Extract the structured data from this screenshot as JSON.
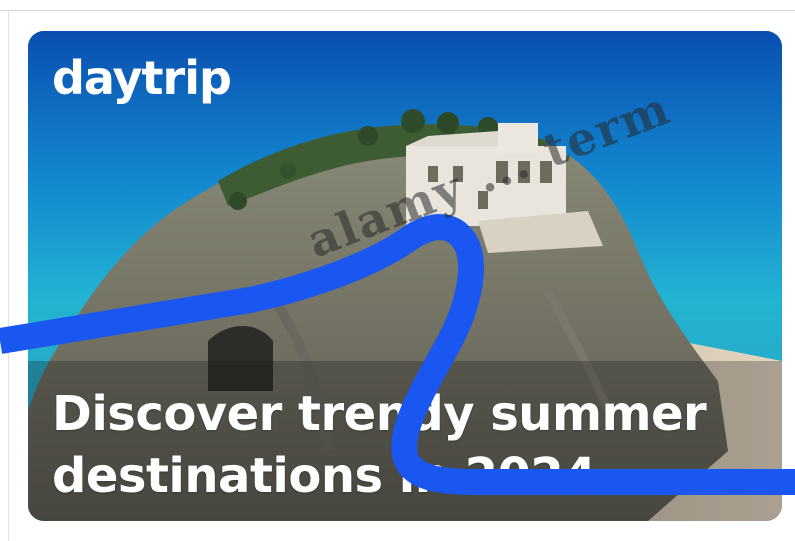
{
  "ad": {
    "brand": "daytrip",
    "headline_line1": "Discover trendy summer",
    "headline_line2": "destinations in 2024",
    "accent_color": "#1a57f0",
    "image_subject": "white cliff-top sanctuary above turquoise sea"
  },
  "watermark": {
    "text": "alamy ... term"
  }
}
